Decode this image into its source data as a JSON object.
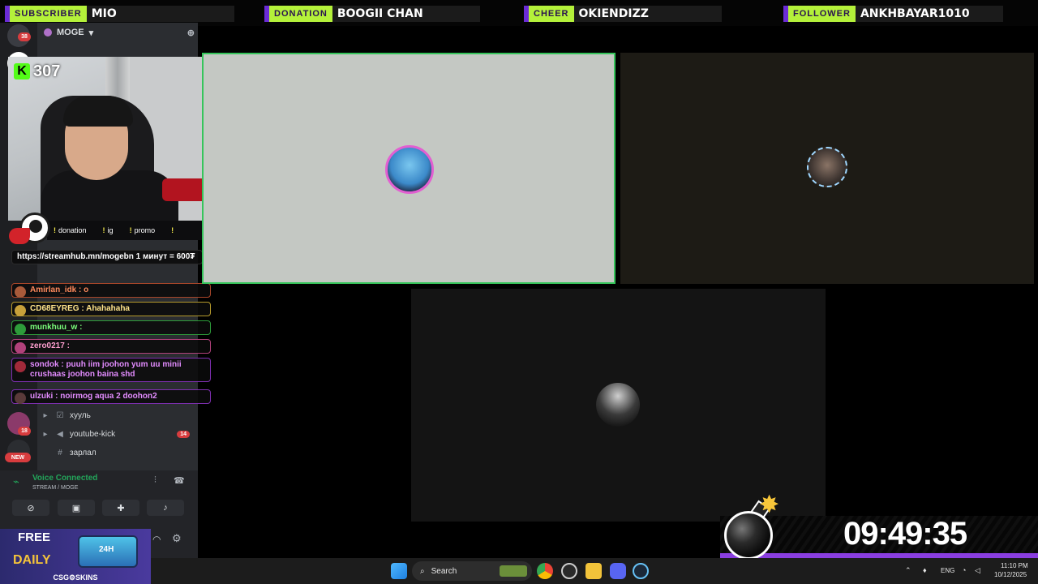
{
  "alerts": [
    {
      "tag": "SUBSCRIBER",
      "name": "MIO"
    },
    {
      "tag": "DONATION",
      "name": "BOOGII CHAN"
    },
    {
      "tag": "CHEER",
      "name": "OKIENDIZZ"
    },
    {
      "tag": "FOLLOWER",
      "name": "ANKHBAYAR1010"
    }
  ],
  "discord": {
    "server_name": "MOGE",
    "server_badge": "38",
    "rail_badge_2": "18",
    "new_label": "NEW",
    "channels": [
      {
        "name": "хууль",
        "icon": "checkbox-icon"
      },
      {
        "name": "youtube-kick",
        "icon": "megaphone-icon",
        "count": "14"
      },
      {
        "name": "зарлал",
        "icon": "hash-icon"
      }
    ],
    "voice_status": "Voice Connected",
    "voice_channel": "STREAM / MOGE"
  },
  "kick": {
    "viewer_count": "307"
  },
  "commands": [
    {
      "bang": "!",
      "label": "donation"
    },
    {
      "bang": "!",
      "label": "ig"
    },
    {
      "bang": "!",
      "label": "promo"
    },
    {
      "bang": "!",
      "label": ""
    }
  ],
  "chat": [
    {
      "text": "https://streamhub.mn/mogebn 1 минут = 600₮",
      "color": "#7fd2ff",
      "border": "#2b2b2b"
    },
    {
      "text": "Amirlan_idk : o",
      "color": "#ff8a5c",
      "border": "#a8462a"
    },
    {
      "text": "CD68EYREG : Ahahahaha",
      "color": "#ffe48a",
      "border": "#b59a2c"
    },
    {
      "text": "munkhuu_w :",
      "color": "#7bff7b",
      "border": "#2e9c3a"
    },
    {
      "text": "zero0217 :",
      "color": "#ff9fd0",
      "border": "#b0417a"
    },
    {
      "text": "sondok : puuh iim joohon yum uu minii crushaas joohon baina shd",
      "color": "#e38cff",
      "border": "#7e2fb0"
    },
    {
      "text": "ulzuki : noirmog aqua 2 doohon2",
      "color": "#e38cff",
      "border": "#7e2fb0"
    }
  ],
  "timer": {
    "value": "09:49:35"
  },
  "ad": {
    "top": "FREE",
    "bottom": "DAILY",
    "chest": "24H",
    "brand": "CSG⚙SKINS"
  },
  "taskbar": {
    "search": "Search",
    "lang": "ENG",
    "time": "11:10 PM",
    "date": "10/12/2025"
  },
  "colors": {
    "accent": "#b4f13a",
    "purple": "#8a3ee0",
    "kick": "#53fc18",
    "active_border": "#36c55b"
  }
}
